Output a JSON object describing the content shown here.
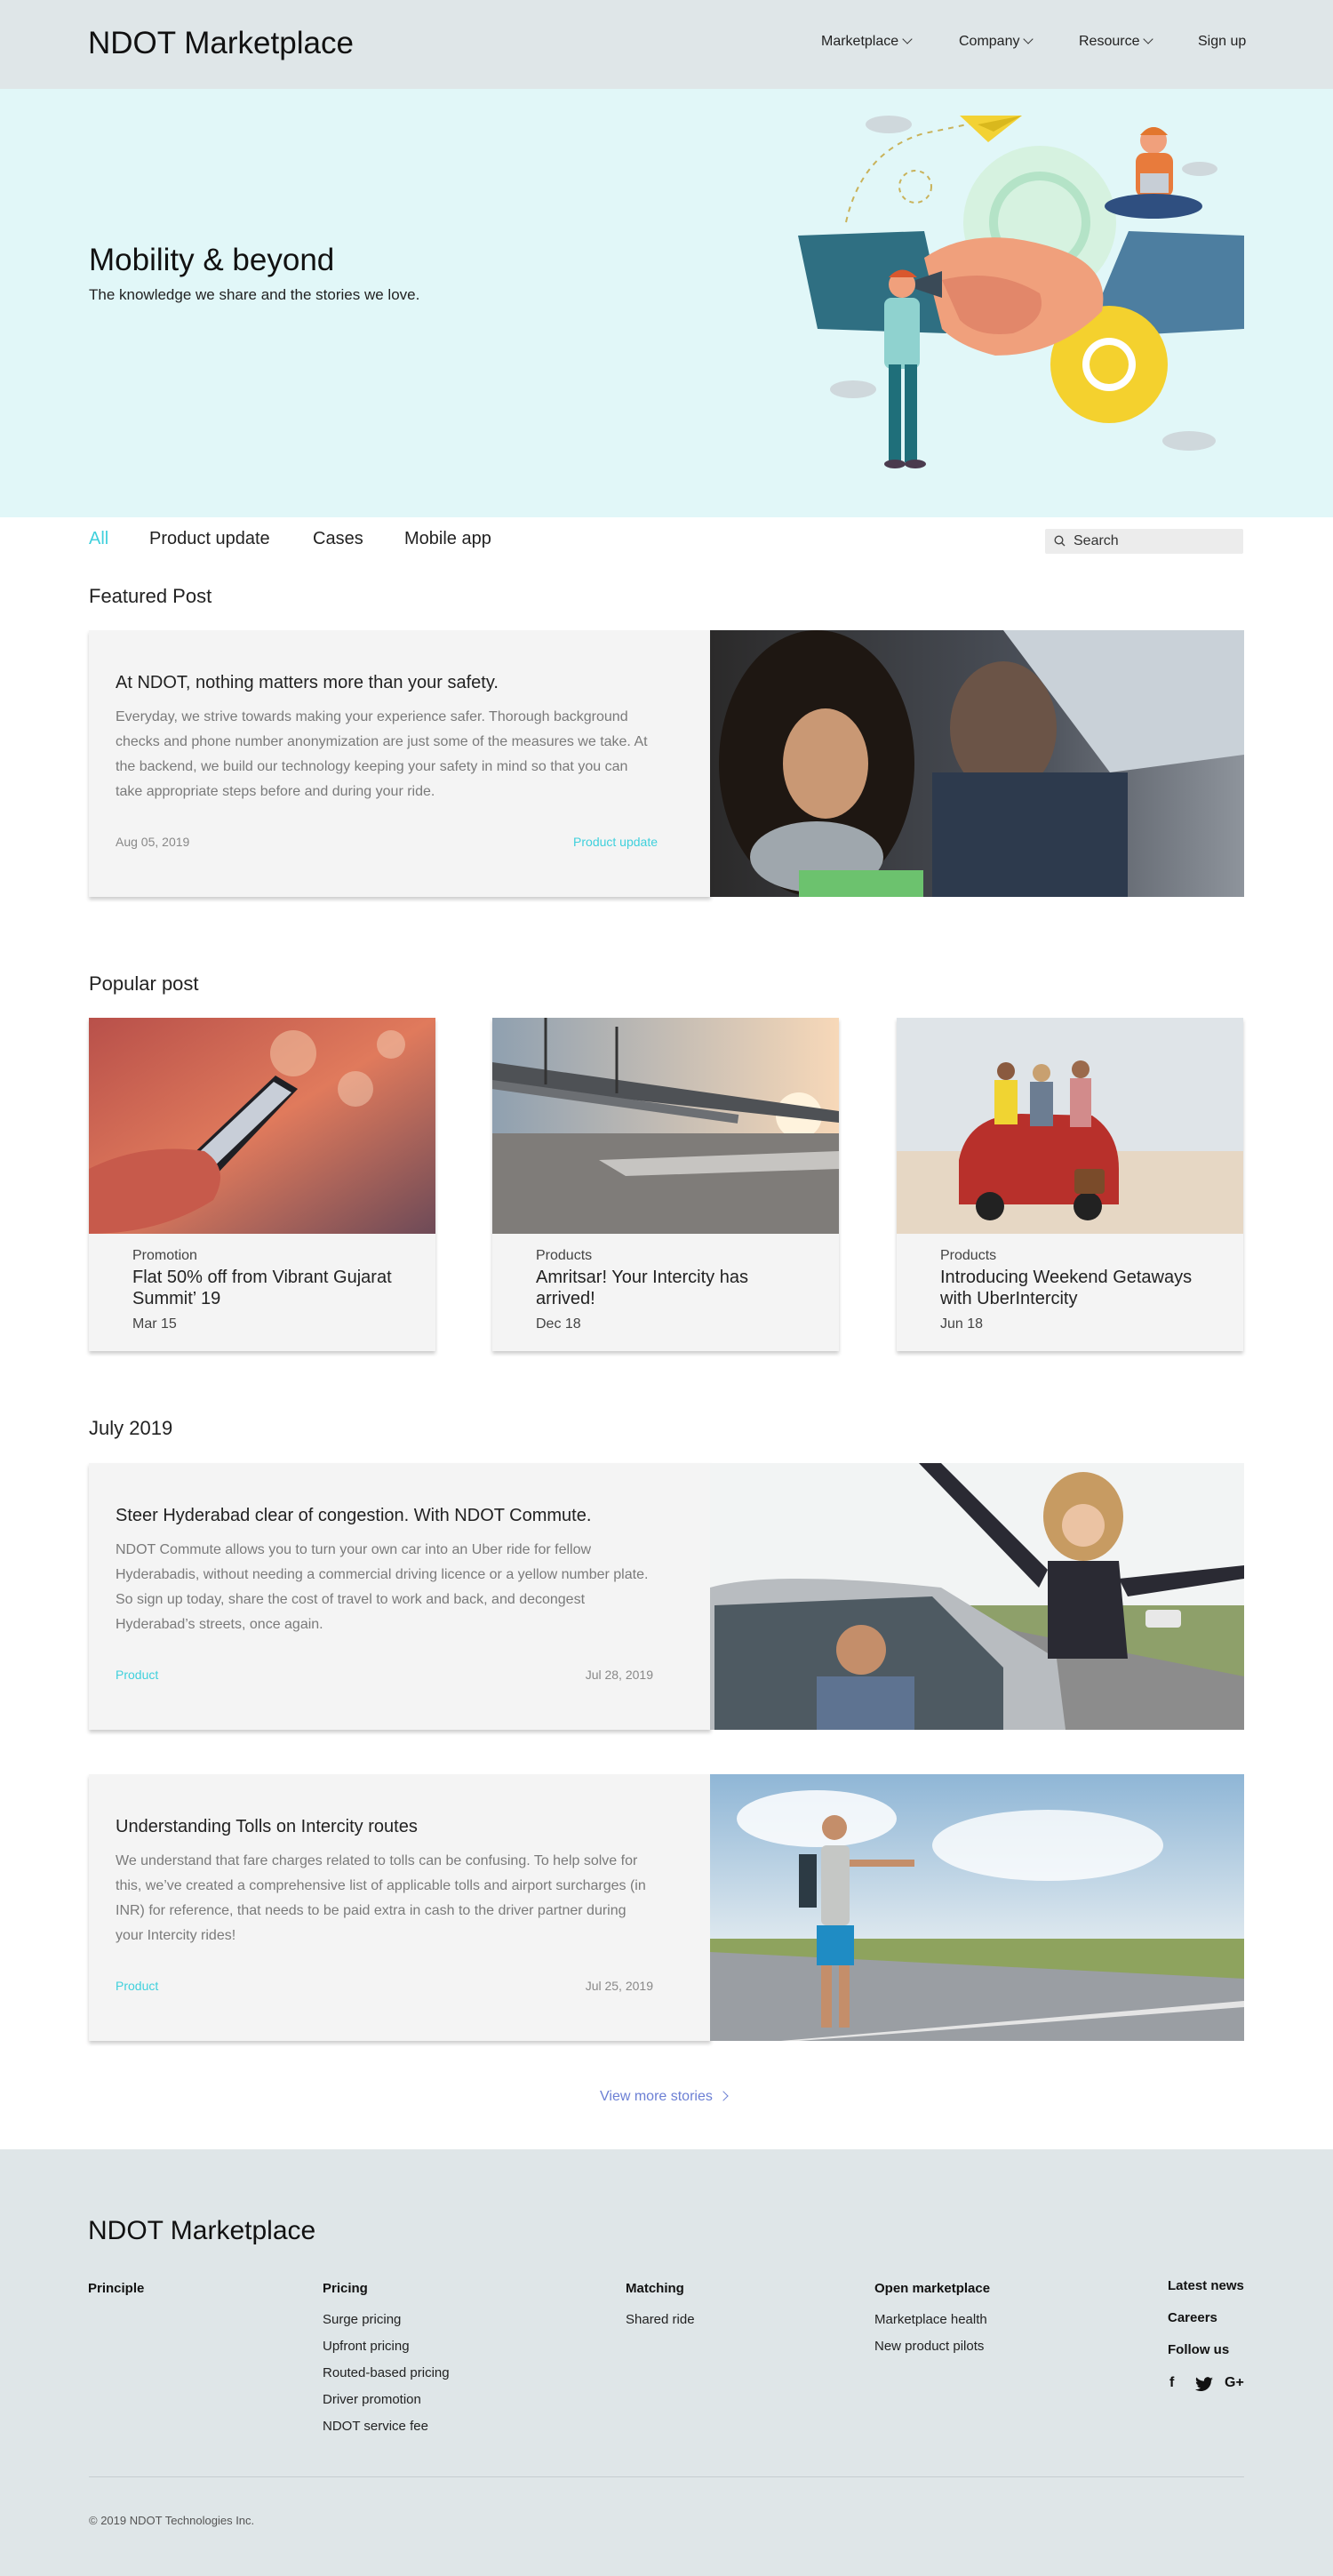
{
  "header": {
    "logo_bold": "NDOT",
    "logo_light": "Marketplace",
    "nav": [
      {
        "label": "Marketplace"
      },
      {
        "label": "Company"
      },
      {
        "label": "Resource"
      },
      {
        "label": "Sign up"
      }
    ]
  },
  "hero": {
    "title": "Mobility & beyond",
    "subtitle": "The knowledge we share and the stories we love."
  },
  "filters": {
    "items": [
      "All",
      "Product update",
      "Cases",
      "Mobile app"
    ],
    "active": "All"
  },
  "search": {
    "placeholder": "Search"
  },
  "featured": {
    "section_title": "Featured Post",
    "title": "At NDOT, nothing matters more than your safety.",
    "body": "Everyday, we strive towards making your experience safer. Thorough background checks and phone number anonymization are just some of the measures we take. At the backend, we build our technology keeping your safety in mind so that you can take appropriate steps before and during your ride.",
    "date": "Aug 05, 2019",
    "category": "Product update"
  },
  "popular": {
    "section_title": "Popular post",
    "cards": [
      {
        "category": "Promotion",
        "title": "Flat 50% off from Vibrant Gujarat Summit’ 19",
        "date": "Mar 15"
      },
      {
        "category": "Products",
        "title": "Amritsar! Your Intercity has arrived!",
        "date": "Dec 18"
      },
      {
        "category": "Products",
        "title": "Introducing Weekend Getaways with UberIntercity",
        "date": "Jun 18"
      }
    ]
  },
  "month": {
    "section_title": "July 2019",
    "posts": [
      {
        "title": "Steer Hyderabad clear of congestion. With NDOT Commute.",
        "body": "NDOT Commute allows you to turn your own car into an Uber ride for fellow Hyderabadis, without needing a commercial driving licence or a yellow number plate. So sign up today, share the cost of travel to work and back, and decongest Hyderabad’s streets, once again.",
        "category": "Product",
        "date": "Jul 28, 2019"
      },
      {
        "title": "Understanding Tolls on Intercity routes",
        "body": "We understand that fare charges related to tolls can be confusing. To help solve for this, we’ve created a comprehensive list of applicable tolls and airport surcharges (in INR) for reference, that needs to be paid extra in cash to the driver partner during your Intercity rides!",
        "category": "Product",
        "date": "Jul 25, 2019"
      }
    ]
  },
  "more": {
    "label": "View more stories"
  },
  "footer": {
    "logo_bold": "NDOT",
    "logo_light": "Marketplace",
    "columns": [
      {
        "heading": "Principle",
        "links": []
      },
      {
        "heading": "Pricing",
        "links": [
          "Surge pricing",
          "Upfront pricing",
          "Routed-based pricing",
          "Driver promotion",
          "NDOT service fee"
        ]
      },
      {
        "heading": "Matching",
        "links": [
          "Shared ride"
        ]
      },
      {
        "heading": "Open marketplace",
        "links": [
          "Marketplace health",
          "New product pilots"
        ]
      }
    ],
    "right": [
      "Latest news",
      "Careers",
      "Follow us"
    ],
    "social": [
      "f",
      "G+"
    ],
    "copyright": "© 2019 NDOT Technologies Inc."
  }
}
